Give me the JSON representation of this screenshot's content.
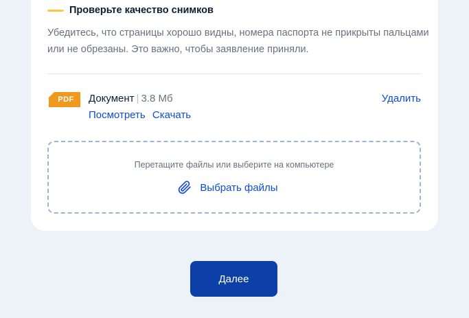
{
  "notice": {
    "title": "Проверьте качество снимков",
    "text": "Убедитесь, что страницы хорошо видны, номера паспорта не прикрыты пальцами или не обрезаны. Это важно, чтобы заявление приняли.",
    "accent_color": "#f8cc41"
  },
  "file": {
    "type_badge": "PDF",
    "name": "Документ",
    "separator": "|",
    "size": "3.8 Мб",
    "view_label": "Посмотреть",
    "download_label": "Скачать",
    "delete_label": "Удалить",
    "badge_color": "#ef9a1f"
  },
  "dropzone": {
    "hint": "Перетащите файлы или выберите на компьютере",
    "pick_label": "Выбрать файлы",
    "icon": "paperclip-icon"
  },
  "actions": {
    "next_label": "Далее",
    "primary_color": "#0d3fa9",
    "link_color": "#0d4cd3"
  }
}
